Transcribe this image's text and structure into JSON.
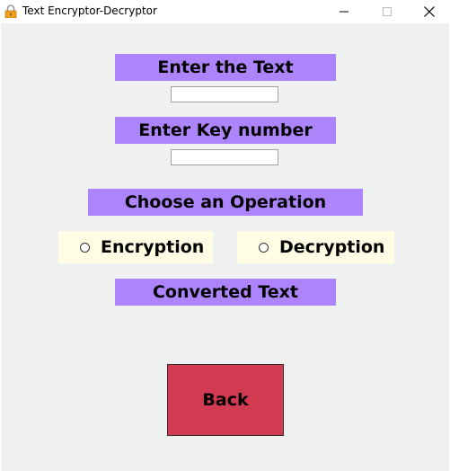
{
  "window": {
    "title": "Text Encryptor-Decryptor",
    "icon": "lock-icon"
  },
  "form": {
    "text_label": "Enter the Text",
    "text_value": "",
    "key_label": "Enter Key number",
    "key_value": "",
    "operation_label": "Choose an Operation",
    "encryption_option": "Encryption",
    "decryption_option": "Decryption",
    "converted_label": "Converted Text",
    "back_label": "Back"
  },
  "colors": {
    "label_bg": "#ae84fc",
    "radio_bg": "#fffde3",
    "back_button_bg": "#d13a50",
    "client_bg": "#eef1f0"
  }
}
